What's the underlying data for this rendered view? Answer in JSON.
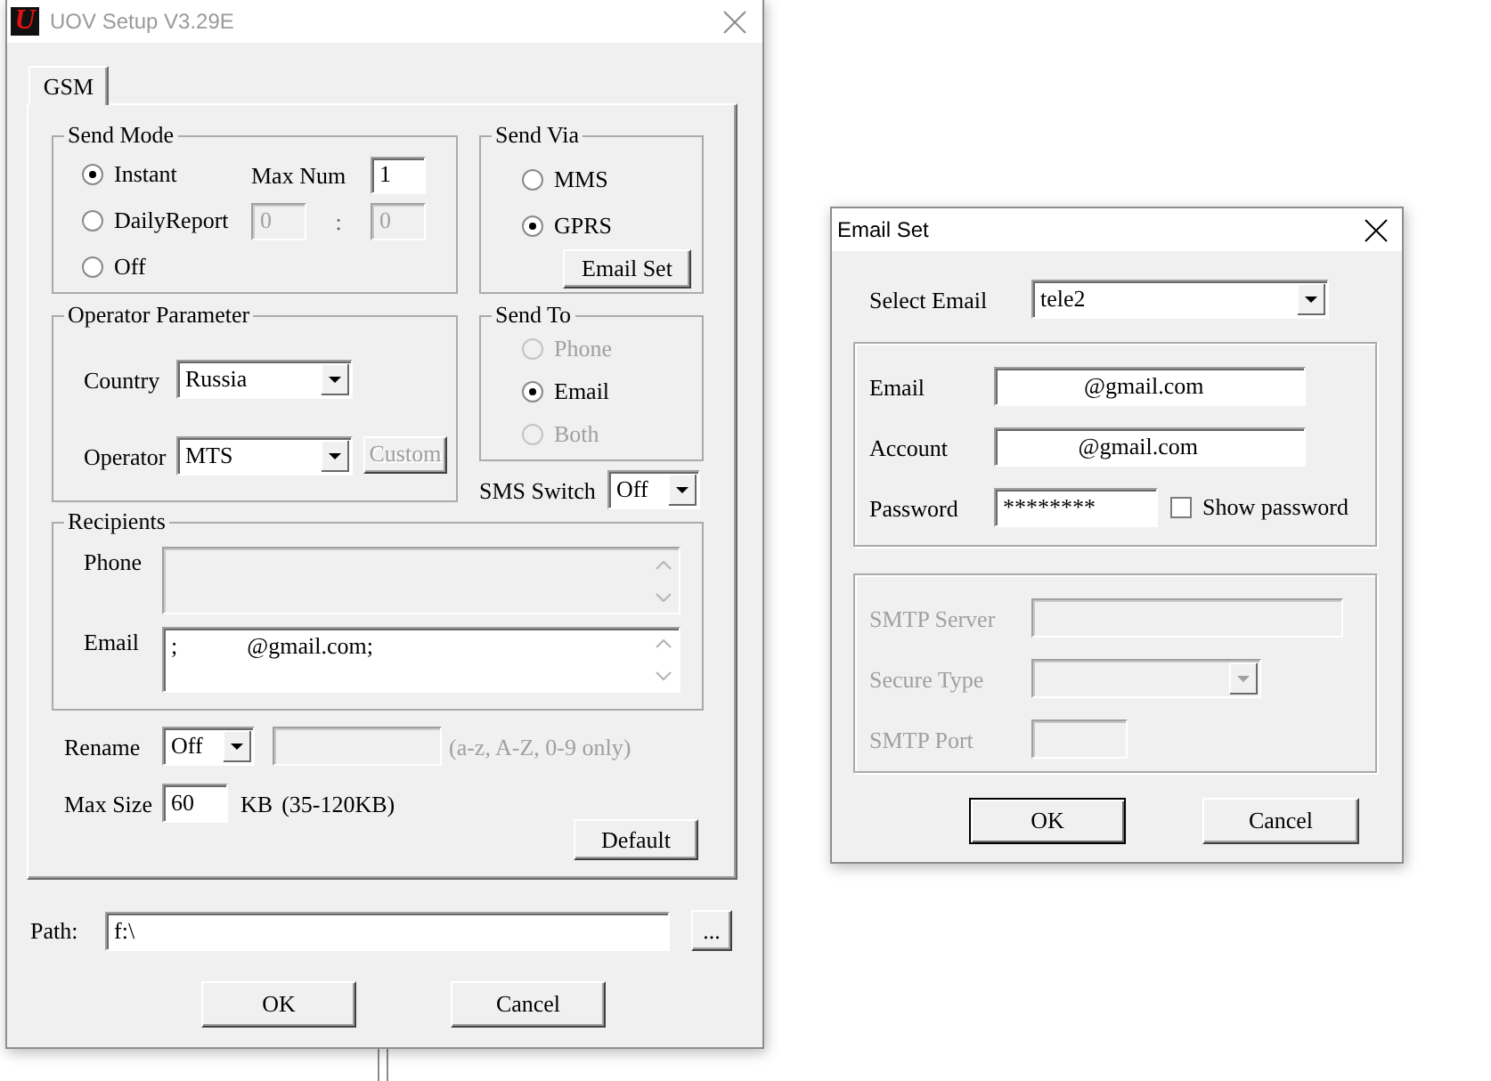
{
  "main_window": {
    "title": "UOV Setup V3.29E",
    "logo": "U",
    "active": false
  },
  "tabs": [
    {
      "label": "GSM",
      "selected": true
    }
  ],
  "send_mode": {
    "title": "Send Mode",
    "options": [
      {
        "label": "Instant",
        "selected": true
      },
      {
        "label": "DailyReport",
        "selected": false
      },
      {
        "label": "Off",
        "selected": false
      }
    ],
    "max_num": {
      "label": "Max Num",
      "value": "1"
    },
    "daily_time": {
      "hour": "0",
      "separator": ":",
      "minute": "0",
      "disabled": true
    }
  },
  "send_via": {
    "title": "Send Via",
    "options": [
      {
        "label": "MMS",
        "selected": false
      },
      {
        "label": "GPRS",
        "selected": true
      }
    ],
    "email_set_button": "Email Set"
  },
  "operator_parameter": {
    "title": "Operator Parameter",
    "country": {
      "label": "Country",
      "value": "Russia"
    },
    "operator": {
      "label": "Operator",
      "value": "MTS"
    },
    "custom_button": {
      "label": "Custom",
      "disabled": true
    }
  },
  "send_to": {
    "title": "Send To",
    "options": [
      {
        "label": "Phone",
        "selected": false,
        "disabled": true
      },
      {
        "label": "Email",
        "selected": true,
        "disabled": false
      },
      {
        "label": "Both",
        "selected": false,
        "disabled": true
      }
    ]
  },
  "sms_switch": {
    "label": "SMS Switch",
    "value": "Off"
  },
  "recipients": {
    "title": "Recipients",
    "fields": [
      {
        "label": "Phone",
        "disabled": true
      },
      {
        "label": "Email",
        "value": ";            @gmail.com;",
        "disabled": false
      }
    ]
  },
  "rename": {
    "label": "Rename",
    "value": "Off",
    "name_field_disabled": true,
    "hint": "(a-z, A-Z, 0-9 only)"
  },
  "max_size": {
    "label": "Max Size",
    "value": "60",
    "unit": "KB",
    "range": "(35-120KB)"
  },
  "default_button": "Default",
  "path": {
    "label": "Path:",
    "value": "f:\\",
    "browse_button": "..."
  },
  "buttons": [
    "OK",
    "Cancel"
  ],
  "email_dialog": {
    "title": "Email Set",
    "active": true,
    "select_email": {
      "label": "Select Email",
      "value": "tele2"
    },
    "account_fields": [
      {
        "kind": "text",
        "label": "Email",
        "value": "              @gmail.com"
      },
      {
        "kind": "text",
        "label": "Account",
        "value": "             @gmail.com"
      },
      {
        "kind": "password",
        "label": "Password",
        "value": "********"
      }
    ],
    "show_password": {
      "label": "Show password",
      "checked": false
    },
    "smtp_fields": [
      {
        "kind": "text",
        "label": "SMTP Server",
        "disabled": true
      },
      {
        "kind": "select",
        "label": "Secure Type",
        "disabled": true
      },
      {
        "kind": "text",
        "label": "SMTP Port",
        "disabled": true
      }
    ],
    "buttons": [
      {
        "label": "OK",
        "default": true
      },
      {
        "label": "Cancel",
        "default": false
      }
    ]
  }
}
